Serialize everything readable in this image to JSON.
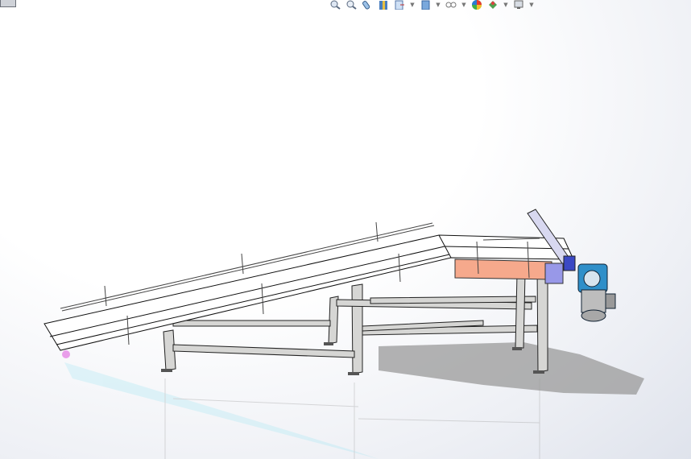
{
  "toolbar": {
    "icons": [
      {
        "name": "zoom-to-fit-icon",
        "has_dropdown": false
      },
      {
        "name": "zoom-to-area-icon",
        "has_dropdown": false
      },
      {
        "name": "previous-view-icon",
        "has_dropdown": false
      },
      {
        "name": "section-view-icon",
        "has_dropdown": false
      },
      {
        "name": "view-orientation-icon",
        "has_dropdown": true
      },
      {
        "name": "display-style-icon",
        "has_dropdown": true
      },
      {
        "name": "hide-show-items-icon",
        "has_dropdown": true
      },
      {
        "name": "edit-appearance-icon",
        "has_dropdown": false
      },
      {
        "name": "apply-scene-icon",
        "has_dropdown": true
      },
      {
        "name": "view-settings-icon",
        "has_dropdown": true
      }
    ]
  },
  "model": {
    "colors": {
      "frame": "#d6d6d4",
      "belt": "#ffffff",
      "side_panel": "#f6a98c",
      "motor": "#2f8fc9",
      "bracket": "#8e8ee6",
      "shadow": "#9a9a9a"
    }
  }
}
